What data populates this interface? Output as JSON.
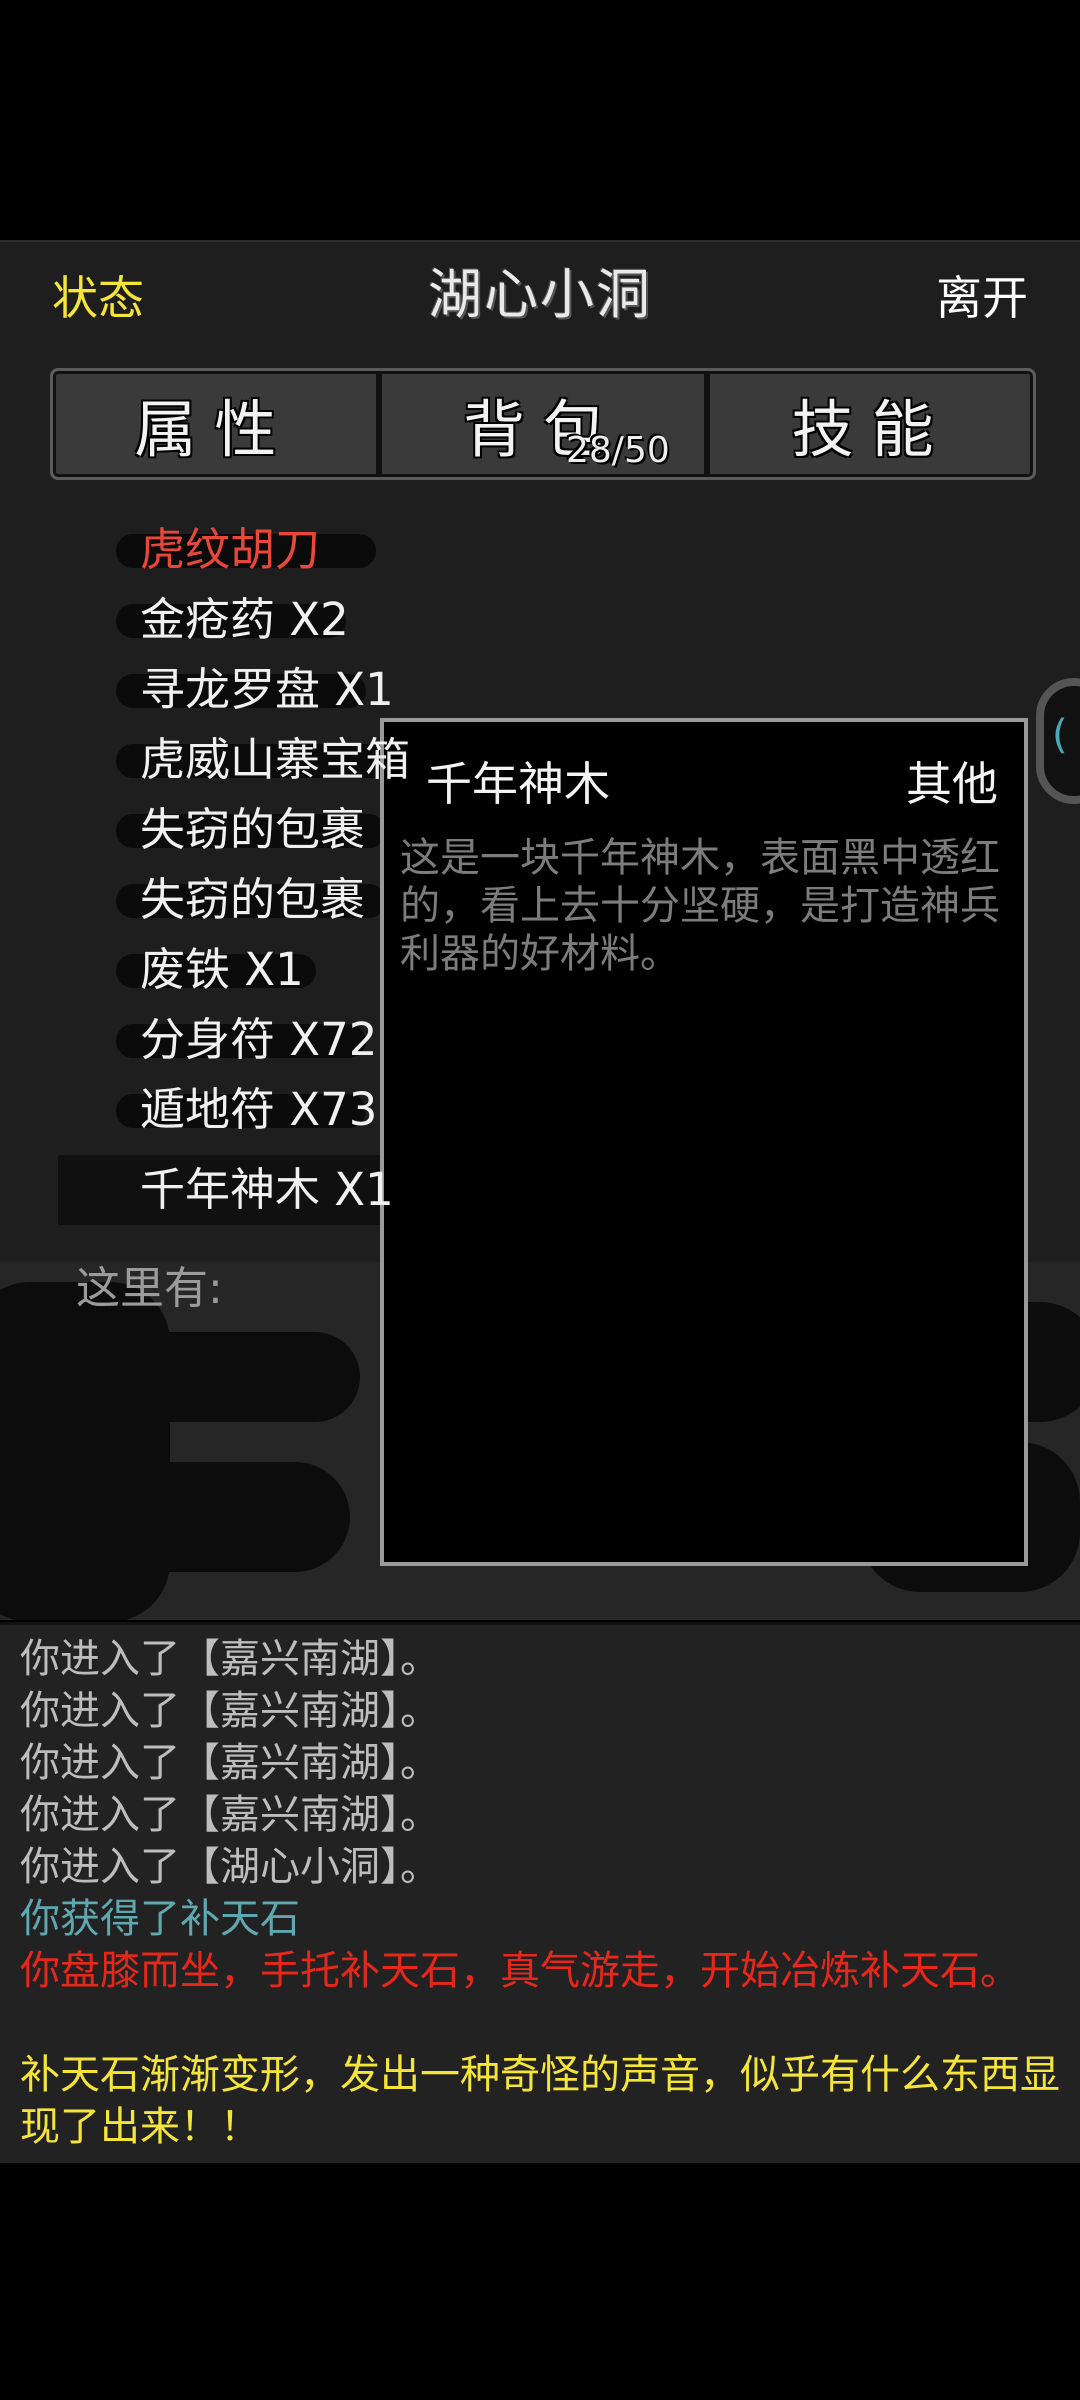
{
  "header": {
    "status": "状态",
    "title": "湖心小洞",
    "leave": "离开"
  },
  "tabs": [
    {
      "label": "属性"
    },
    {
      "label": "背包"
    },
    {
      "label": "技能"
    }
  ],
  "bag_count": "28/50",
  "items": [
    {
      "label": "虎纹胡刀",
      "color": "#e8473b"
    },
    {
      "label": "金疮药 X2",
      "color": "#f0f0f0"
    },
    {
      "label": "寻龙罗盘 X1",
      "color": "#f0f0f0"
    },
    {
      "label": "虎威山寨宝箱",
      "color": "#f0f0f0"
    },
    {
      "label": "失窃的包裹",
      "color": "#f0f0f0"
    },
    {
      "label": "失窃的包裹",
      "color": "#f0f0f0"
    },
    {
      "label": "废铁 X1",
      "color": "#f0f0f0"
    },
    {
      "label": "分身符 X72",
      "color": "#f0f0f0"
    },
    {
      "label": "遁地符 X73",
      "color": "#f0f0f0"
    },
    {
      "label": "千年神木 X1",
      "color": "#f0f0f0"
    }
  ],
  "scene": {
    "label": "这里有:"
  },
  "popup": {
    "name": "千年神木",
    "type": "其他",
    "description": "这是一块千年神木，表面黑中透红的，看上去十分坚硬，是打造神兵利器的好材料。"
  },
  "edge_icon": "refresh-icon",
  "log": [
    {
      "text": "你进入了【嘉兴南湖】。",
      "color": "#bdbdbd"
    },
    {
      "text": "你进入了【嘉兴南湖】。",
      "color": "#bdbdbd"
    },
    {
      "text": "你进入了【嘉兴南湖】。",
      "color": "#bdbdbd"
    },
    {
      "text": "你进入了【嘉兴南湖】。",
      "color": "#bdbdbd"
    },
    {
      "text": "你进入了【湖心小洞】。",
      "color": "#bdbdbd"
    },
    {
      "text": "你获得了补天石",
      "color": "#5fa8b0"
    },
    {
      "text": "你盘膝而坐，手托补天石，真气游走，开始冶炼补天石。",
      "color": "#e8271b"
    },
    {
      "text": "补天石渐渐变形，发出一种奇怪的声音，似乎有什么东西显现了出来！！",
      "color": "#f5e43a"
    }
  ],
  "colors": {
    "accent_yellow": "#f5e43a",
    "accent_red": "#e8271b",
    "accent_teal": "#5fa8b0"
  }
}
